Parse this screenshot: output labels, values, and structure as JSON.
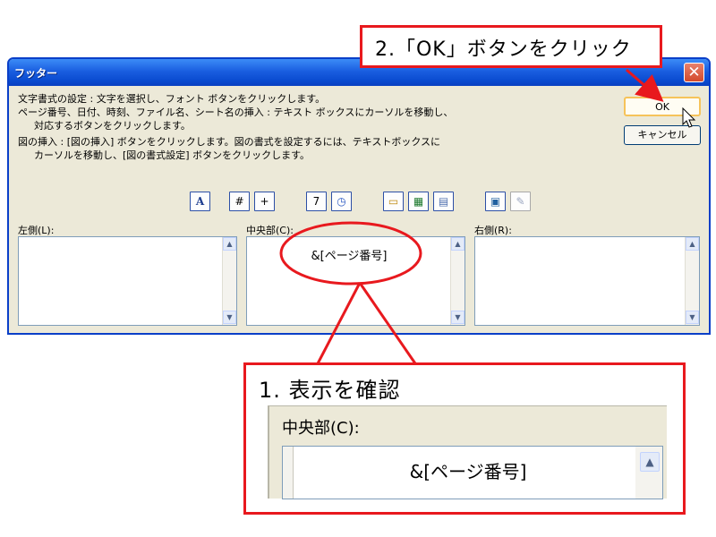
{
  "dialog": {
    "title": "フッター",
    "close_glyph": "✕",
    "instructions": [
      "文字書式の設定 : 文字を選択し、フォント ボタンをクリックします。",
      "ページ番号、日付、時刻、ファイル名、シート名の挿入 : テキスト ボックスにカーソルを移動し、",
      "対応するボタンをクリックします。",
      "図の挿入 : [図の挿入] ボタンをクリックします。図の書式を設定するには、テキストボックスに",
      "カーソルを移動し、[図の書式設定] ボタンをクリックします。"
    ],
    "ok_label": "OK",
    "cancel_label": "キャンセル",
    "toolbar": {
      "font_glyph": "A",
      "page_number_glyph": "#",
      "page_count_glyph": "+",
      "date_glyph": "7",
      "time_glyph": "◷",
      "file_path_glyph": "▭",
      "file_name_glyph": "▦",
      "sheet_name_glyph": "▤",
      "insert_picture_glyph": "▣",
      "format_picture_glyph": "✎"
    },
    "left_label": "左側(L):",
    "center_label": "中央部(C):",
    "right_label": "右側(R):",
    "center_text": "&[ページ番号]",
    "scroll_up_glyph": "▲",
    "scroll_down_glyph": "▼"
  },
  "callouts": {
    "step2": "2.「OK」ボタンをクリック",
    "step1": "1. 表示を確認",
    "zoom_label": "中央部(C):",
    "zoom_text": "&[ページ番号]"
  },
  "colors": {
    "callout_red": "#e8191e",
    "titlebar_blue": "#0a4bd0",
    "dialog_bg": "#ece9d8"
  }
}
